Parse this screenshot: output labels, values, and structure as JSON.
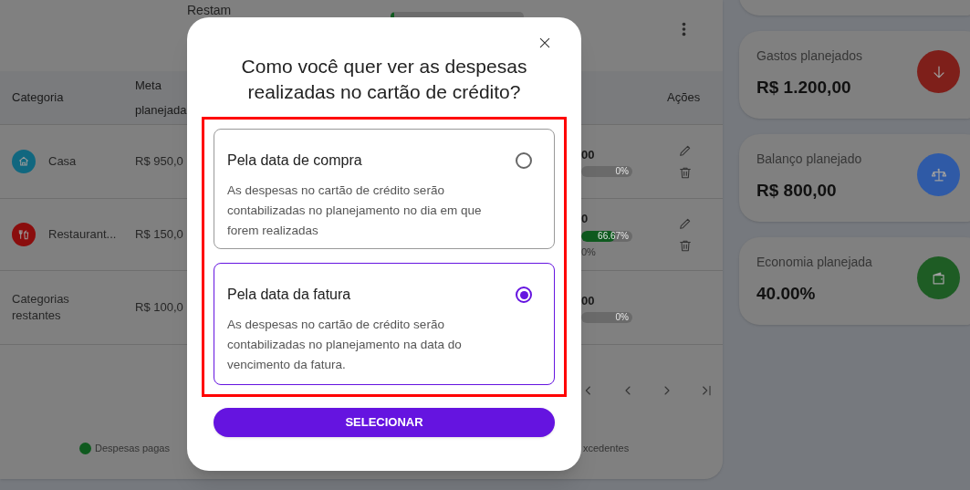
{
  "summary": {
    "remaining_label": "Restam",
    "progress": {
      "level": 0.03
    }
  },
  "table": {
    "columns": [
      {
        "label": "Categoria"
      },
      {
        "label": "Meta\nplanejada"
      },
      {
        "label": "Ações"
      }
    ],
    "rows": [
      {
        "category": "Casa",
        "kind": "house",
        "color": "#11677f",
        "goal": "R$ 950,0",
        "amount": "00",
        "level": 0,
        "bar_label": "0%"
      },
      {
        "category": "Restaurant...",
        "kind": "food",
        "color": "#8a0d0d",
        "goal": "R$ 150,0",
        "amount": "0",
        "level": 0.6667,
        "bar_label": "66.67%",
        "note": "0%"
      },
      {
        "category": "Categorias restantes",
        "kind": "none",
        "goal": "R$ 100,0",
        "amount": "00",
        "level": 0,
        "bar_label": "0%"
      }
    ]
  },
  "legend": [
    {
      "label": "Despesas pagas",
      "color": "#0f5a1f"
    },
    {
      "label": "xcedentes"
    }
  ],
  "cards": [
    {
      "label": "Gastos planejados",
      "value": "R$ 1.200,00",
      "kind": "expense",
      "color": "#7e1f1a"
    },
    {
      "label": "Balanço planejado",
      "value": "R$ 800,00",
      "kind": "balance",
      "color": "#2f5aa6"
    },
    {
      "label": "Economia planejada",
      "value": "40.00%",
      "kind": "savings",
      "color": "#1e5c24"
    }
  ],
  "modal": {
    "title": "Como você quer ver as despesas realizadas no cartão de crédito?",
    "options": [
      {
        "title": "Pela data de compra",
        "description": "As despesas no cartão de crédito serão contabilizadas no planejamento no dia em que forem realizadas",
        "selected": false
      },
      {
        "title": "Pela data da fatura",
        "description": "As despesas no cartão de crédito serão contabilizadas no planejamento na data do vencimento da fatura.",
        "selected": true
      }
    ],
    "button": "SELECIONAR"
  }
}
